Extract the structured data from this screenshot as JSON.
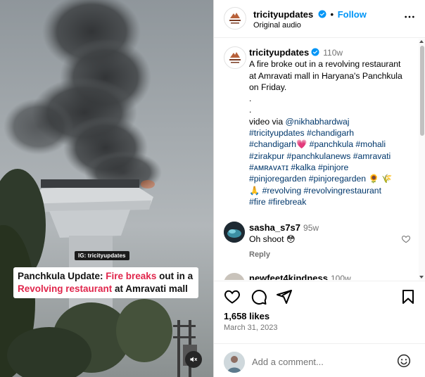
{
  "media": {
    "watermark": "IG: tricityupdates",
    "banner": {
      "part1": "Panchkula Update: ",
      "part2": "Fire breaks",
      "part3": " out in a",
      "part4": "Revolving restaurant",
      "part5": " at Amravati mall"
    },
    "mute_icon": "speaker-muted-icon",
    "muted": true
  },
  "header": {
    "username": "tricityupdates",
    "separator": "•",
    "follow_label": "Follow",
    "subtitle": "Original audio",
    "verified_icon": "verified-badge-icon",
    "more_icon": "more-options-icon"
  },
  "caption": {
    "username": "tricityupdates",
    "time": "110w",
    "text": "A fire broke out in a revolving restaurant at Amravati mall in Haryana's Panchkula on Friday.",
    "dot1": ".",
    "dot2": ".",
    "credit_prefix": "video via ",
    "credit_handle": "@nikhabhardwaj",
    "hashtags": {
      "h1": "#tricityupdates",
      "h2": "#chandigarh",
      "h3": "#chandigarh",
      "h3_emoji": "💗",
      "h4": "#panchkula",
      "h5": "#mohali",
      "h6": "#zirakpur",
      "h7": "#panchkulanews",
      "h8": "#amravati",
      "h9": "#ᴀᴍʀᴀᴠᴀᴛɪ",
      "h10": "#kalka",
      "h11": "#pinjore",
      "h12": "#pinjoregarden",
      "h13": "#pinjoregarden",
      "h13_emoji": "🌻 🌾",
      "h14_emoji": "🙏",
      "h14": "#revolving",
      "h15": "#revolvingrestaurant",
      "h16": "#fire",
      "h17": "#firebreak"
    }
  },
  "comments": [
    {
      "username": "sasha_s7s7",
      "time": "95w",
      "text": "Oh shoot",
      "emoji": "😳",
      "reply_label": "Reply",
      "like_icon": "heart-outline-icon"
    },
    {
      "username": "newfeet4kindness",
      "time": "100w"
    }
  ],
  "actions": {
    "like_icon": "heart-outline-icon",
    "comment_icon": "comment-icon",
    "share_icon": "share-icon",
    "save_icon": "bookmark-icon",
    "likes": "1,658 likes",
    "date": "March 31, 2023"
  },
  "add_comment": {
    "placeholder": "Add a comment...",
    "emoji_icon": "smiley-icon"
  },
  "colors": {
    "accent": "#0095f6",
    "link": "#00376b",
    "banner_red": "#e0254b",
    "muted_text": "#737373"
  }
}
